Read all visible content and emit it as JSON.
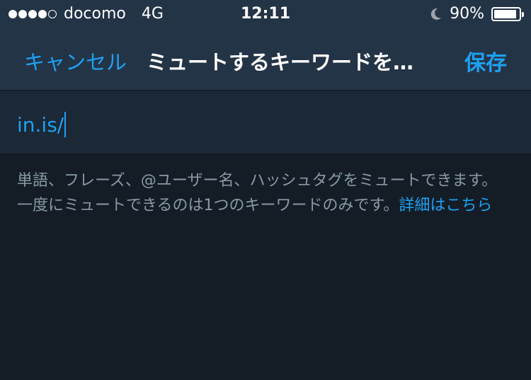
{
  "status_bar": {
    "carrier": "docomo",
    "network": "4G",
    "time": "12:11",
    "battery_percent": "90%",
    "battery_level": 0.9,
    "signal_strength": 4,
    "signal_max": 5
  },
  "nav": {
    "cancel_label": "キャンセル",
    "title": "ミュートするキーワードを…",
    "save_label": "保存"
  },
  "keyword_input": {
    "value": "in.is/"
  },
  "help": {
    "text": "単語、フレーズ、@ユーザー名、ハッシュタグをミュートできます。一度にミュートできるのは1つのキーワードのみです。",
    "link_label": "詳細はこちら"
  },
  "colors": {
    "background": "#141d26",
    "bar": "#243447",
    "accent": "#1da1f2",
    "muted_text": "#8899a6"
  },
  "icons": [
    "signal-icon",
    "moon-icon",
    "battery-icon"
  ]
}
